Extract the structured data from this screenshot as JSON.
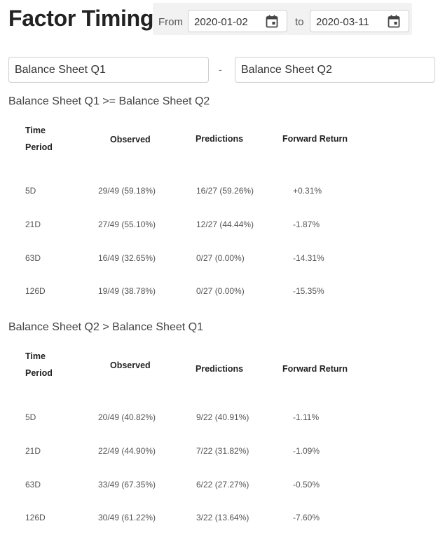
{
  "header": {
    "title": "Factor Timing",
    "from_label": "From",
    "to_label": "to",
    "start_date": "2020-01-02",
    "end_date": "2020-03-11",
    "calendar_icon": "calendar-icon"
  },
  "factors": {
    "left": "Balance Sheet Q1",
    "separator": "-",
    "right": "Balance Sheet Q2"
  },
  "columns": {
    "period_line1": "Time",
    "period_line2": "Period",
    "observed": "Observed",
    "predictions": "Predictions",
    "forward_return": "Forward Return"
  },
  "sections": [
    {
      "title": "Balance Sheet Q1 >= Balance Sheet Q2",
      "rows": [
        {
          "period": "5D",
          "observed": "29/49 (59.18%)",
          "predictions": "16/27 (59.26%)",
          "forward_return": "+0.31%"
        },
        {
          "period": "21D",
          "observed": "27/49 (55.10%)",
          "predictions": "12/27 (44.44%)",
          "forward_return": "-1.87%"
        },
        {
          "period": "63D",
          "observed": "16/49 (32.65%)",
          "predictions": "0/27 (0.00%)",
          "forward_return": "-14.31%"
        },
        {
          "period": "126D",
          "observed": "19/49 (38.78%)",
          "predictions": "0/27 (0.00%)",
          "forward_return": "-15.35%"
        }
      ]
    },
    {
      "title": "Balance Sheet Q2 > Balance Sheet Q1",
      "rows": [
        {
          "period": "5D",
          "observed": "20/49 (40.82%)",
          "predictions": "9/22 (40.91%)",
          "forward_return": "-1.11%"
        },
        {
          "period": "21D",
          "observed": "22/49 (44.90%)",
          "predictions": "7/22 (31.82%)",
          "forward_return": "-1.09%"
        },
        {
          "period": "63D",
          "observed": "33/49 (67.35%)",
          "predictions": "6/22 (27.27%)",
          "forward_return": "-0.50%"
        },
        {
          "period": "126D",
          "observed": "30/49 (61.22%)",
          "predictions": "3/22 (13.64%)",
          "forward_return": "-7.60%"
        }
      ]
    }
  ]
}
